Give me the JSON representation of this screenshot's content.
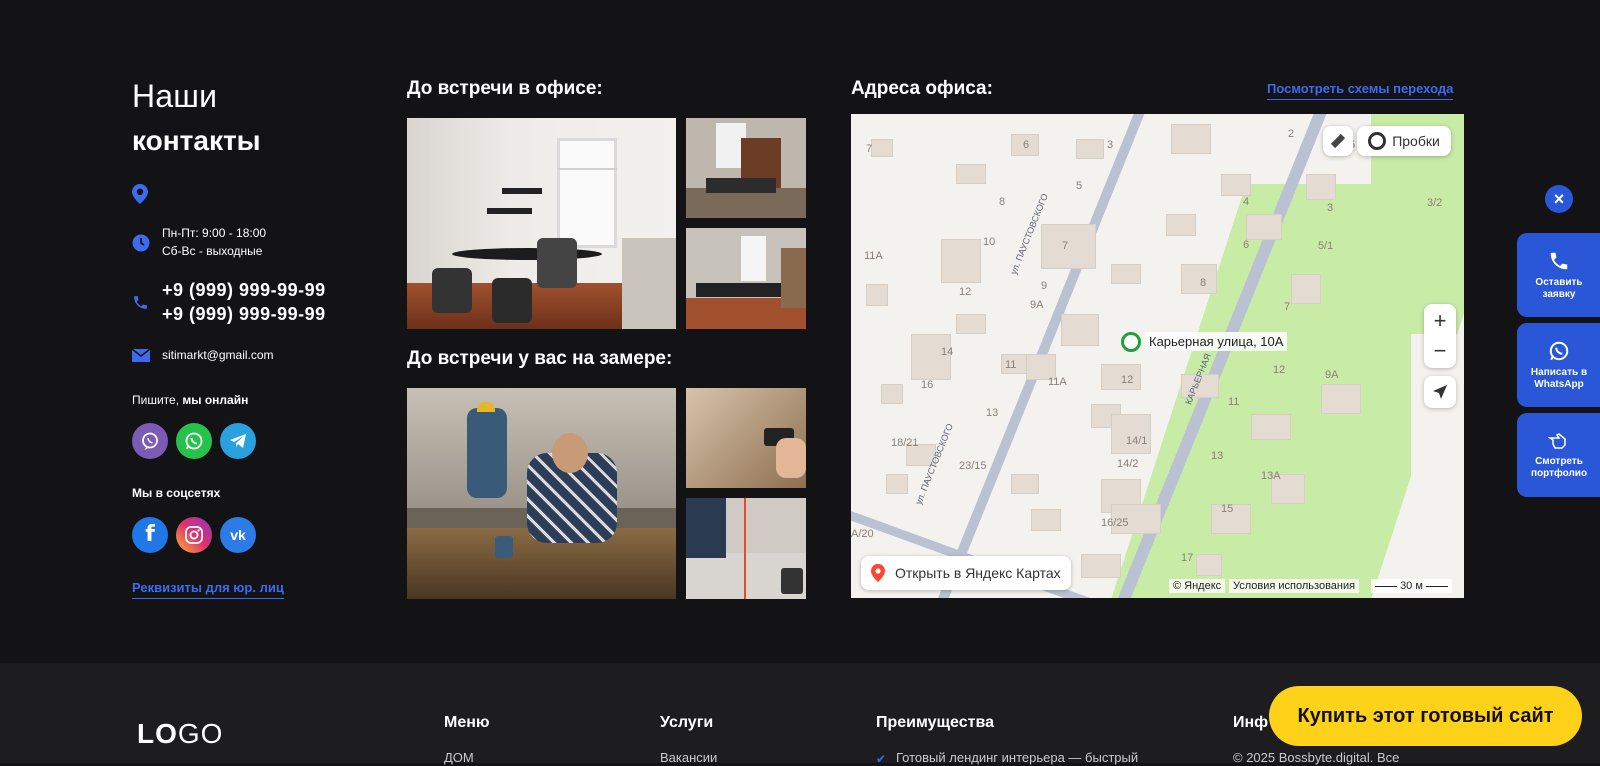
{
  "contacts": {
    "title_light": "Наши",
    "title_bold": "контакты",
    "hours_line1": "Пн-Пт: 9:00 - 18:00",
    "hours_line2": "Сб-Вс - выходные",
    "phone1": "+9 (999) 999-99-99",
    "phone2": "+9 (999) 999-99-99",
    "email": "sitimarkt@gmail.com",
    "write_us_prefix": "Пишите, ",
    "write_us_bold": "мы онлайн",
    "social_title": "Мы в соцсетях",
    "requisites_link": "Реквизиты для юр. лиц"
  },
  "gallery": {
    "office_title": "До встречи в офисе:",
    "onsite_title": "До встречи у вас на замере:"
  },
  "address": {
    "title": "Адреса офиса:",
    "schemes_link": "Посмотреть схемы перехода"
  },
  "map": {
    "traffic_label": "Пробки",
    "marker_label": "Карьерная улица, 10А",
    "open_in_yandex": "Открыть в Яндекс Картах",
    "copyright": "© Яндекс",
    "terms": "Условия использования",
    "scale": "30 м",
    "street1": "ул. ПАУСТОВСКОГО",
    "street2": "ул. ПАУСТОВСКОГО",
    "street3": "КАРЬЕРНАЯ",
    "house_numbers": [
      "7",
      "6",
      "3",
      "2",
      "5",
      "8",
      "5",
      "4",
      "3",
      "3/2",
      "10",
      "7",
      "6",
      "5/1",
      "11А",
      "12",
      "9",
      "9А",
      "8",
      "7",
      "12",
      "14",
      "11",
      "11А",
      "12",
      "9А",
      "16",
      "13",
      "11",
      "14/1",
      "14/2",
      "13",
      "18/21",
      "23/15",
      "13А",
      "16/25",
      "15",
      "17",
      "А/20"
    ]
  },
  "side": {
    "close": "×",
    "request": "Оставить заявку",
    "whatsapp": "Написать в WhatsApp",
    "portfolio": "Смотреть портфолио"
  },
  "footer": {
    "logo_bold": "LO",
    "logo_light": "GO",
    "menu_title": "Меню",
    "menu_item": "ДОМ",
    "services_title": "Услуги",
    "services_item": "Вакансии",
    "advantages_title": "Преимущества",
    "advantages_item": "Готовый лендинг интерьера — быстрый",
    "info_title": "Инф",
    "copyright": "© 2025 Bossbyte.digital. Все"
  },
  "buy_button": "Купить этот готовый сайт",
  "colors": {
    "accent": "#2a56d8",
    "background": "#131316",
    "buy_button": "#ffd21a"
  }
}
